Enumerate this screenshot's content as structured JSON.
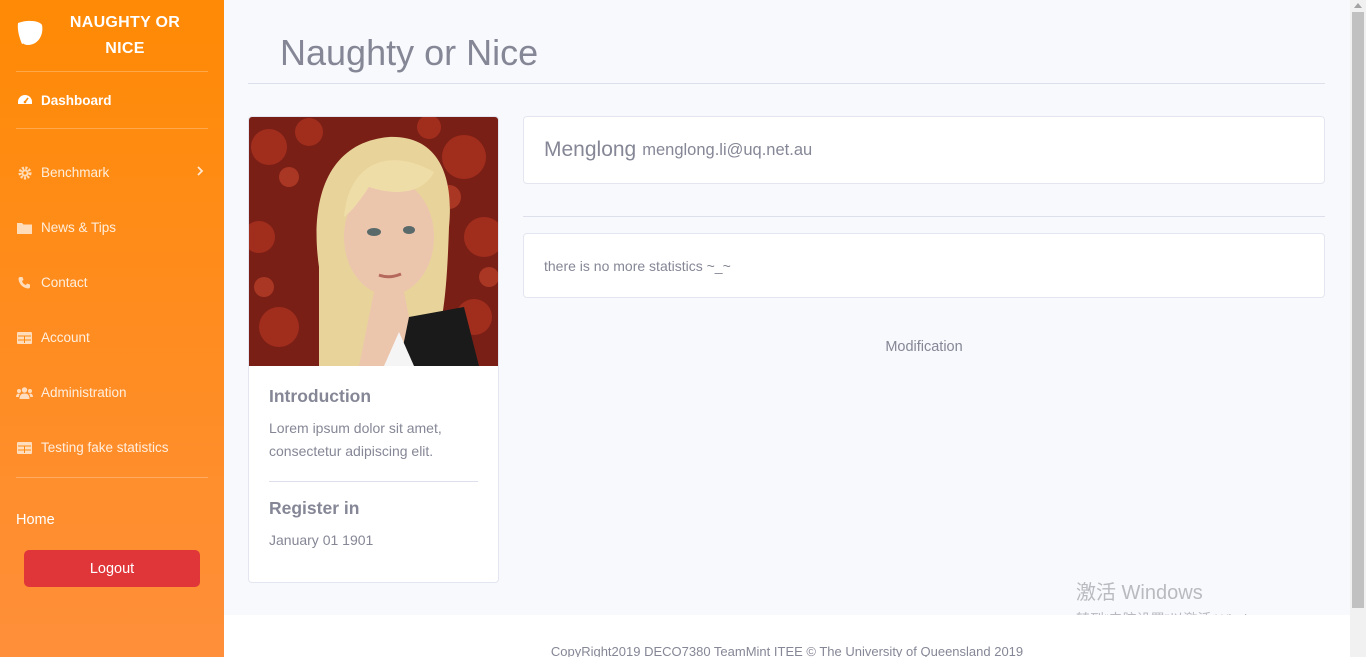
{
  "brand": {
    "line1": "NAUGHTY OR",
    "line2": "NICE",
    "icon": "leaf-icon"
  },
  "sidebar": {
    "items": [
      {
        "label": "Dashboard",
        "icon": "tachometer-icon",
        "active": true
      },
      {
        "label": "Benchmark",
        "icon": "gear-icon",
        "has_submenu": true
      },
      {
        "label": "News & Tips",
        "icon": "folder-icon"
      },
      {
        "label": "Contact",
        "icon": "phone-icon"
      },
      {
        "label": "Account",
        "icon": "table-icon"
      },
      {
        "label": "Administration",
        "icon": "users-icon"
      },
      {
        "label": "Testing fake statistics",
        "icon": "table-icon"
      }
    ],
    "home_label": "Home",
    "logout_label": "Logout"
  },
  "main": {
    "title": "Naughty or Nice",
    "profile": {
      "intro_heading": "Introduction",
      "intro_text": "Lorem ipsum dolor sit amet, consectetur adipiscing elit.",
      "register_heading": "Register in",
      "register_date": "January 01 1901"
    },
    "user": {
      "name": "Menglong",
      "email": "menglong.li@uq.net.au"
    },
    "stats_text": "there is no more statistics ~_~",
    "modification_label": "Modification"
  },
  "footer": {
    "text": "CopyRight2019 DECO7380 TeamMint ITEE © The University of Queensland 2019"
  },
  "watermark": {
    "line1": "激活 Windows",
    "line2": "转到“电脑设置”以激活 Windows。"
  },
  "colors": {
    "sidebar_top": "#ff8a05",
    "sidebar_bottom": "#ff8f3a",
    "logout": "#e0363a",
    "text_gray": "#858796",
    "page_bg": "#f8f9fc"
  }
}
